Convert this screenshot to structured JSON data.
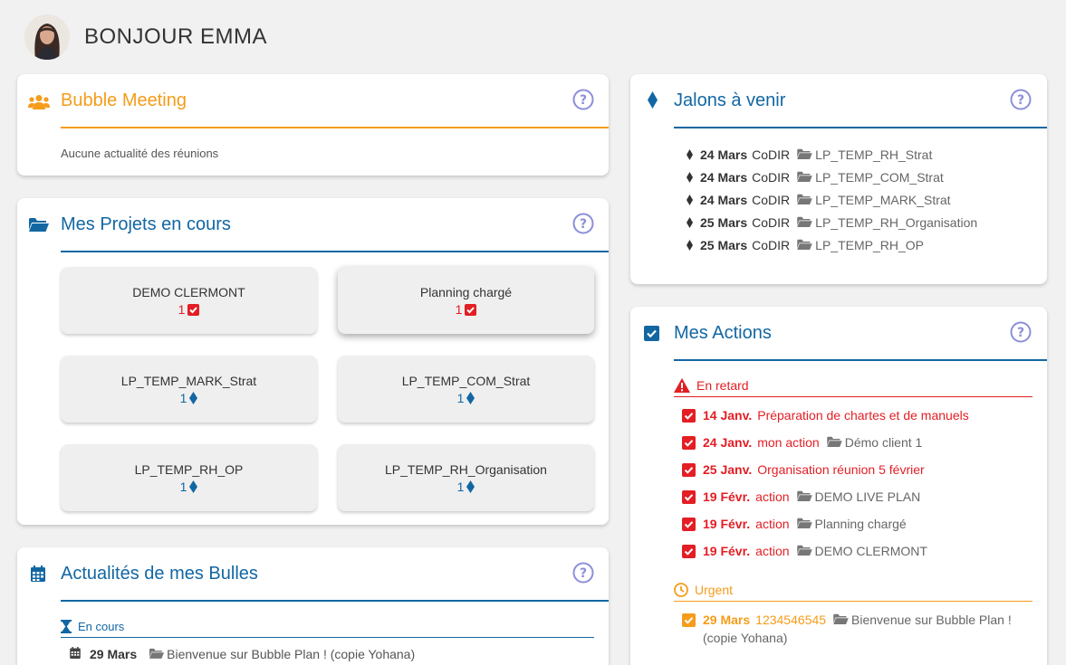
{
  "header": {
    "greeting": "BONJOUR EMMA"
  },
  "bubble_meeting": {
    "title": "Bubble Meeting",
    "empty_text": "Aucune actualité des réunions"
  },
  "projects": {
    "title": "Mes Projets en cours",
    "tiles": [
      {
        "name": "DEMO CLERMONT",
        "count": "1",
        "kind": "action"
      },
      {
        "name": "Planning chargé",
        "count": "1",
        "kind": "action"
      },
      {
        "name": "LP_TEMP_MARK_Strat",
        "count": "1",
        "kind": "milestone"
      },
      {
        "name": "LP_TEMP_COM_Strat",
        "count": "1",
        "kind": "milestone"
      },
      {
        "name": "LP_TEMP_RH_OP",
        "count": "1",
        "kind": "milestone"
      },
      {
        "name": "LP_TEMP_RH_Organisation",
        "count": "1",
        "kind": "milestone"
      }
    ]
  },
  "news": {
    "title": "Actualités de mes Bulles",
    "section_label": "En cours",
    "items": [
      {
        "date": "29 Mars",
        "project": "Bienvenue sur Bubble Plan ! (copie Yohana)"
      }
    ]
  },
  "milestones": {
    "title": "Jalons à venir",
    "items": [
      {
        "date": "24 Mars",
        "label": "CoDIR",
        "project": "LP_TEMP_RH_Strat"
      },
      {
        "date": "24 Mars",
        "label": "CoDIR",
        "project": "LP_TEMP_COM_Strat"
      },
      {
        "date": "24 Mars",
        "label": "CoDIR",
        "project": "LP_TEMP_MARK_Strat"
      },
      {
        "date": "25 Mars",
        "label": "CoDIR",
        "project": "LP_TEMP_RH_Organisation"
      },
      {
        "date": "25 Mars",
        "label": "CoDIR",
        "project": "LP_TEMP_RH_OP"
      }
    ]
  },
  "actions": {
    "title": "Mes Actions",
    "late_label": "En retard",
    "urgent_label": "Urgent",
    "late_items": [
      {
        "date": "14 Janv.",
        "label": "Préparation de chartes et de manuels",
        "project": ""
      },
      {
        "date": "24 Janv.",
        "label": "mon action",
        "project": "Démo client 1"
      },
      {
        "date": "25 Janv.",
        "label": "Organisation réunion 5 février",
        "project": ""
      },
      {
        "date": "19 Févr.",
        "label": "action",
        "project": "DEMO LIVE PLAN"
      },
      {
        "date": "19 Févr.",
        "label": "action",
        "project": "Planning chargé"
      },
      {
        "date": "19 Févr.",
        "label": "action",
        "project": "DEMO CLERMONT"
      }
    ],
    "urgent_items": [
      {
        "date": "29 Mars",
        "label": "1234546545",
        "project": "Bienvenue sur Bubble Plan !",
        "project_cont": "(copie Yohana)"
      }
    ]
  },
  "colors": {
    "orange": "#f59c1a",
    "blue": "#1267a3",
    "red": "#e31e24",
    "help": "#8c8fd9"
  }
}
